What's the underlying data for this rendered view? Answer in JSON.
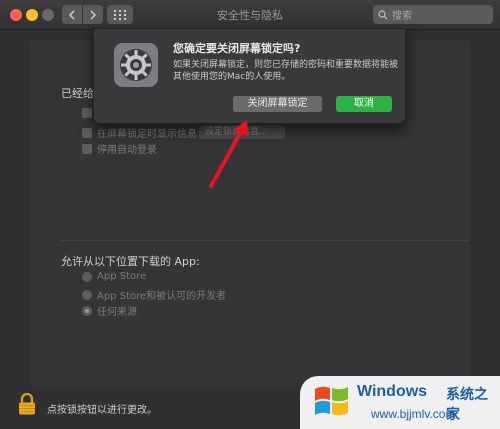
{
  "window": {
    "title": "安全性与隐私",
    "search_placeholder": "搜索"
  },
  "panel": {
    "general_label": "已经给",
    "options": [
      {
        "label": "在屏幕锁定时显示信息",
        "checked": false
      },
      {
        "label": "停用自动登录",
        "checked": false
      }
    ],
    "set_message_button": "设定锁屏信息...",
    "download_label": "允许从以下位置下载的 App:",
    "download_sources": [
      {
        "label": "App Store",
        "selected": false
      },
      {
        "label": "App Store和被认可的开发者",
        "selected": false
      },
      {
        "label": "任何来源",
        "selected": true
      }
    ]
  },
  "footer": {
    "lock_text": "点按锁按钮以进行更改。"
  },
  "dialog": {
    "title": "您确定要关闭屏幕锁定吗?",
    "message": "如果关闭屏幕锁定，则您已存储的密码和重要数据将能被其他使用您的Mac的人使用。",
    "turn_off_button": "关闭屏幕锁定",
    "cancel_button": "取消",
    "accent_color": "#2db345"
  },
  "watermark": {
    "brand": "Windows",
    "brand_cn": "系统之家",
    "url": "www.bjjmlv.com"
  }
}
